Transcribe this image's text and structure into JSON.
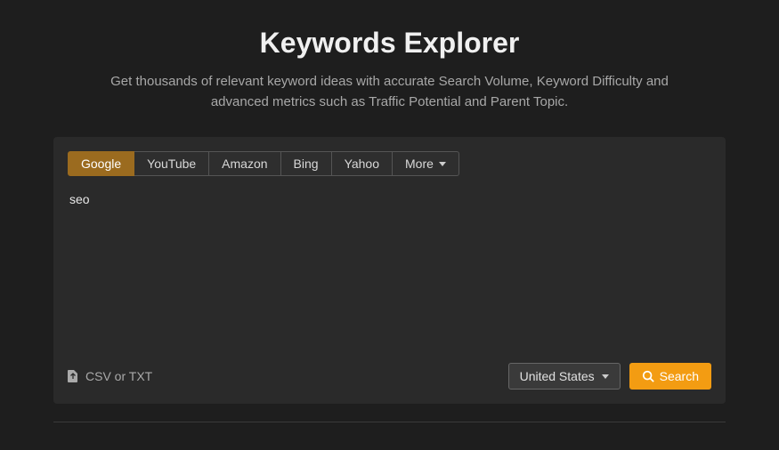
{
  "header": {
    "title": "Keywords Explorer",
    "subtitle": "Get thousands of relevant keyword ideas with accurate Search Volume, Keyword Difficulty and advanced metrics such as Traffic Potential and Parent Topic."
  },
  "tabs": {
    "google": "Google",
    "youtube": "YouTube",
    "amazon": "Amazon",
    "bing": "Bing",
    "yahoo": "Yahoo",
    "more": "More"
  },
  "input": {
    "value": "seo"
  },
  "upload": {
    "label": "CSV or TXT"
  },
  "country": {
    "selected": "United States"
  },
  "search": {
    "label": "Search"
  }
}
